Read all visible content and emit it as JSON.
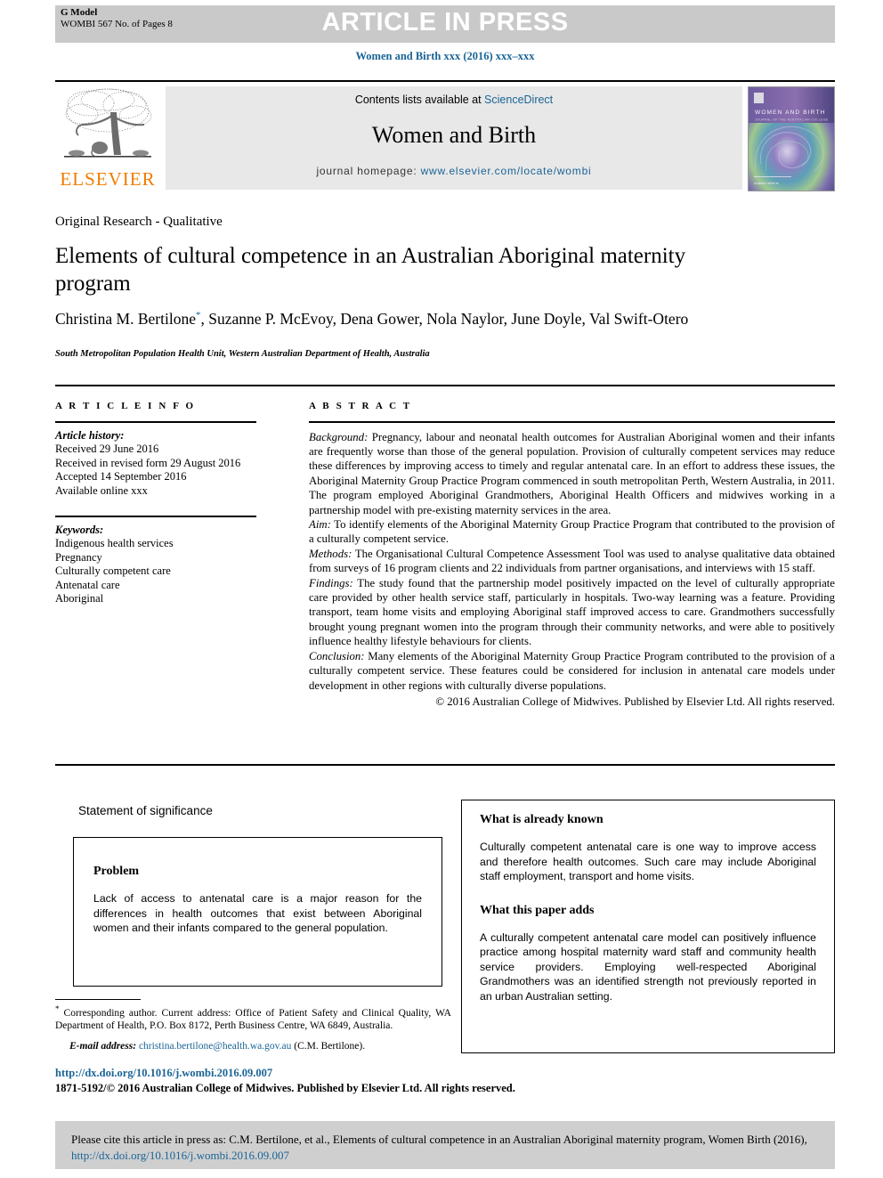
{
  "banner": {
    "g_model": "G Model",
    "wombi_id": "WOMBI 567 No. of Pages 8",
    "article_in_press": "ARTICLE IN PRESS"
  },
  "journal_line": "Women and Birth xxx (2016) xxx–xxx",
  "masthead": {
    "publisher": "ELSEVIER",
    "contents_prefix": "Contents lists available at ",
    "contents_link": "ScienceDirect",
    "journal_name": "Women and Birth",
    "homepage_label": "journal homepage: ",
    "homepage_url": "www.elsevier.com/locate/wombi",
    "cover_title": "WOMEN AND BIRTH",
    "cover_subtitle": "JOURNAL OF THE AUSTRALIAN COLLEGE OF MIDWIVES"
  },
  "article": {
    "section_type": "Original Research - Qualitative",
    "title": "Elements of cultural competence in an Australian Aboriginal maternity program",
    "authors": "Christina M. Bertilone, Suzanne P. McEvoy, Dena Gower, Nola Naylor, June Doyle, Val Swift-Otero",
    "affiliation": "South Metropolitan Population Health Unit, Western Australian Department of Health, Australia"
  },
  "article_info": {
    "heading": "A R T I C L E  I N F O",
    "history_label": "Article history:",
    "history": [
      "Received 29 June 2016",
      "Received in revised form 29 August 2016",
      "Accepted 14 September 2016",
      "Available online xxx"
    ],
    "keywords_label": "Keywords:",
    "keywords": [
      "Indigenous health services",
      "Pregnancy",
      "Culturally competent care",
      "Antenatal care",
      "Aboriginal"
    ]
  },
  "abstract": {
    "heading": "A B S T R A C T",
    "sections": [
      {
        "label": "Background:",
        "text": " Pregnancy, labour and neonatal health outcomes for Australian Aboriginal women and their infants are frequently worse than those of the general population. Provision of culturally competent services may reduce these differences by improving access to timely and regular antenatal care. In an effort to address these issues, the Aboriginal Maternity Group Practice Program commenced in south metropolitan Perth, Western Australia, in 2011. The program employed Aboriginal Grandmothers, Aboriginal Health Officers and midwives working in a partnership model with pre-existing maternity services in the area."
      },
      {
        "label": "Aim:",
        "text": " To identify elements of the Aboriginal Maternity Group Practice Program that contributed to the provision of a culturally competent service."
      },
      {
        "label": "Methods:",
        "text": " The Organisational Cultural Competence Assessment Tool was used to analyse qualitative data obtained from surveys of 16 program clients and 22 individuals from partner organisations, and interviews with 15 staff."
      },
      {
        "label": "Findings:",
        "text": " The study found that the partnership model positively impacted on the level of culturally appropriate care provided by other health service staff, particularly in hospitals. Two-way learning was a feature. Providing transport, team home visits and employing Aboriginal staff improved access to care. Grandmothers successfully brought young pregnant women into the program through their community networks, and were able to positively influence healthy lifestyle behaviours for clients."
      },
      {
        "label": "Conclusion:",
        "text": " Many elements of the Aboriginal Maternity Group Practice Program contributed to the provision of a culturally competent service. These features could be considered for inclusion in antenatal care models under development in other regions with culturally diverse populations."
      }
    ],
    "copyright": "© 2016 Australian College of Midwives. Published by Elsevier Ltd. All rights reserved."
  },
  "statement_of_significance": {
    "title": "Statement of significance",
    "problem_heading": "Problem",
    "problem_text": "Lack of access to antenatal care is a major reason for the differences in health outcomes that exist between Aboriginal women and their infants compared to the general population.",
    "known_heading": "What is already known",
    "known_text": "Culturally competent antenatal care is one way to improve access and therefore health outcomes. Such care may include Aboriginal staff employment, transport and home visits.",
    "adds_heading": "What this paper adds",
    "adds_text": "A culturally competent antenatal care model can positively influence practice among hospital maternity ward staff and community health service providers. Employing well-respected Aboriginal Grandmothers was an identified strength not previously reported in an urban Australian setting."
  },
  "footer": {
    "corresponding_note": "Corresponding author. Current address: Office of Patient Safety and Clinical Quality, WA Department of Health, P.O. Box 8172, Perth Business Centre, WA 6849, Australia.",
    "email_label": "E-mail address:",
    "email": "christina.bertilone@health.wa.gov.au",
    "email_attrib": "(C.M. Bertilone).",
    "doi": "http://dx.doi.org/10.1016/j.wombi.2016.09.007",
    "issn_line": "1871-5192/© 2016 Australian College of Midwives. Published by Elsevier Ltd. All rights reserved."
  },
  "cite_box": {
    "text_prefix": "Please cite this article in press as: C.M. Bertilone, et al., Elements of cultural competence in an Australian Aboriginal maternity program, Women Birth (2016), ",
    "link": "http://dx.doi.org/10.1016/j.wombi.2016.09.007"
  },
  "colors": {
    "link": "#1a6496",
    "banner_bg": "#c9c9c9",
    "masthead_bg": "#e8e8e8",
    "elsevier_orange": "#f07c00",
    "cite_bg": "#cfcfcf"
  }
}
